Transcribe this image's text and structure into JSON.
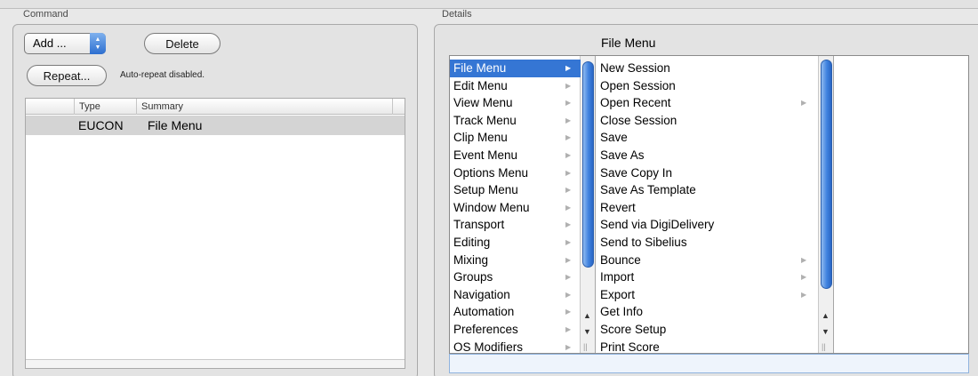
{
  "command": {
    "group_label": "Command",
    "add_label": "Add ...",
    "delete_label": "Delete",
    "repeat_label": "Repeat...",
    "auto_repeat_status": "Auto-repeat disabled.",
    "table": {
      "headers": [
        "Type",
        "Summary"
      ],
      "rows": [
        {
          "type": "EUCON",
          "summary": "File Menu"
        }
      ]
    }
  },
  "details": {
    "group_label": "Details",
    "title": "File Menu",
    "column1": [
      "File Menu",
      "Edit Menu",
      "View Menu",
      "Track Menu",
      "Clip Menu",
      "Event Menu",
      "Options Menu",
      "Setup Menu",
      "Window Menu",
      "Transport",
      "Editing",
      "Mixing",
      "Groups",
      "Navigation",
      "Automation",
      "Preferences",
      "OS Modifiers"
    ],
    "column1_selected": "File Menu",
    "column2": [
      "New Session",
      "Open Session",
      "Open Recent",
      "Close Session",
      "Save",
      "Save As",
      "Save Copy In",
      "Save As Template",
      "Revert",
      "Send via DigiDelivery",
      "Send to Sibelius",
      "Bounce",
      "Import",
      "Export",
      "Get Info",
      "Score Setup",
      "Print Score"
    ],
    "column2_submenus": [
      "Open Recent",
      "Bounce",
      "Import",
      "Export"
    ]
  }
}
